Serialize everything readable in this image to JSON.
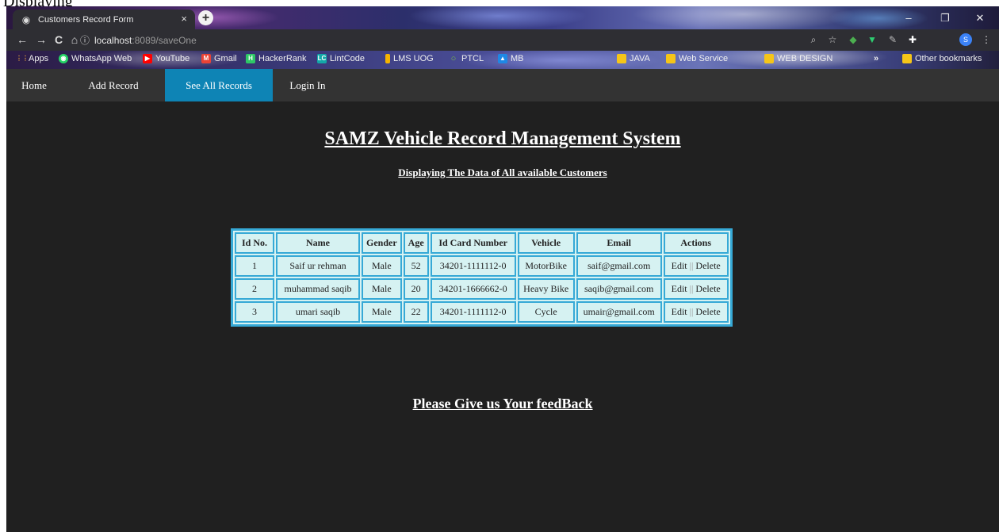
{
  "caption": "Displaying",
  "browser": {
    "tab_title": "Customers Record Form",
    "tab_close": "×",
    "new_tab": "+",
    "url_host": "localhost",
    "url_path": ":8089/saveOne",
    "back": "←",
    "forward": "→",
    "reload": "C",
    "home": "⌂",
    "info": "ⓘ",
    "profile_initial": "S",
    "window_controls": {
      "minimize": "–",
      "maximize": "❐",
      "close": "✕"
    }
  },
  "bookmarks": [
    {
      "label": "Apps",
      "color": "#e8a33d",
      "glyph": "⋮⋮"
    },
    {
      "label": "WhatsApp Web",
      "color": "#25d366",
      "glyph": "◉"
    },
    {
      "label": "YouTube",
      "color": "#ff0000",
      "glyph": "▶"
    },
    {
      "label": "Gmail",
      "color": "#ea4335",
      "glyph": "M"
    },
    {
      "label": "HackerRank",
      "color": "#2ec866",
      "glyph": "H"
    },
    {
      "label": "LintCode",
      "color": "#13a8a8",
      "glyph": "LC"
    },
    {
      "label": "LMS UOG",
      "color": "#f5b400",
      "glyph": "▮"
    },
    {
      "label": "PTCL",
      "color": "#7bc043",
      "glyph": "○"
    },
    {
      "label": "MB",
      "color": "#1e88e5",
      "glyph": "▲"
    },
    {
      "label": "JAVA",
      "color": "#f5c518",
      "glyph": "▮"
    },
    {
      "label": "Web Service",
      "color": "#f5c518",
      "glyph": "▮"
    },
    {
      "label": "WEB DESIGN",
      "color": "#f5c518",
      "glyph": "▮"
    },
    {
      "label": "»",
      "color": "",
      "glyph": ""
    },
    {
      "label": "Other bookmarks",
      "color": "#f5c518",
      "glyph": "▮"
    }
  ],
  "nav": {
    "items": [
      {
        "label": "Home"
      },
      {
        "label": "Add Record"
      },
      {
        "label": "See All Records",
        "active": true
      },
      {
        "label": "Login In"
      }
    ]
  },
  "main": {
    "title": "SAMZ Vehicle Record Management System",
    "subtitle": "Displaying The Data of All available Customers",
    "feedback": "Please Give us Your feedBack"
  },
  "table": {
    "headers": [
      "Id No.",
      "Name",
      "Gender",
      "Age",
      "Id Card Number",
      "Vehicle",
      "Email",
      "Actions"
    ],
    "edit_label": "Edit",
    "separator": "||",
    "delete_label": "Delete",
    "rows": [
      {
        "id": "1",
        "name": "Saif ur rehman",
        "gender": "Male",
        "age": "52",
        "card": "34201-1111112-0",
        "vehicle": "MotorBike",
        "email": "saif@gmail.com"
      },
      {
        "id": "2",
        "name": "muhammad saqib",
        "gender": "Male",
        "age": "20",
        "card": "34201-1666662-0",
        "vehicle": "Heavy Bike",
        "email": "saqib@gmail.com"
      },
      {
        "id": "3",
        "name": "umari saqib",
        "gender": "Male",
        "age": "22",
        "card": "34201-1111112-0",
        "vehicle": "Cycle",
        "email": "umair@gmail.com"
      }
    ]
  },
  "colors": {
    "accent": "#0e84b5",
    "table_border": "#36a9d6",
    "table_bg": "#d6f2f2",
    "page_bg": "#202020",
    "nav_bg": "#333333"
  }
}
